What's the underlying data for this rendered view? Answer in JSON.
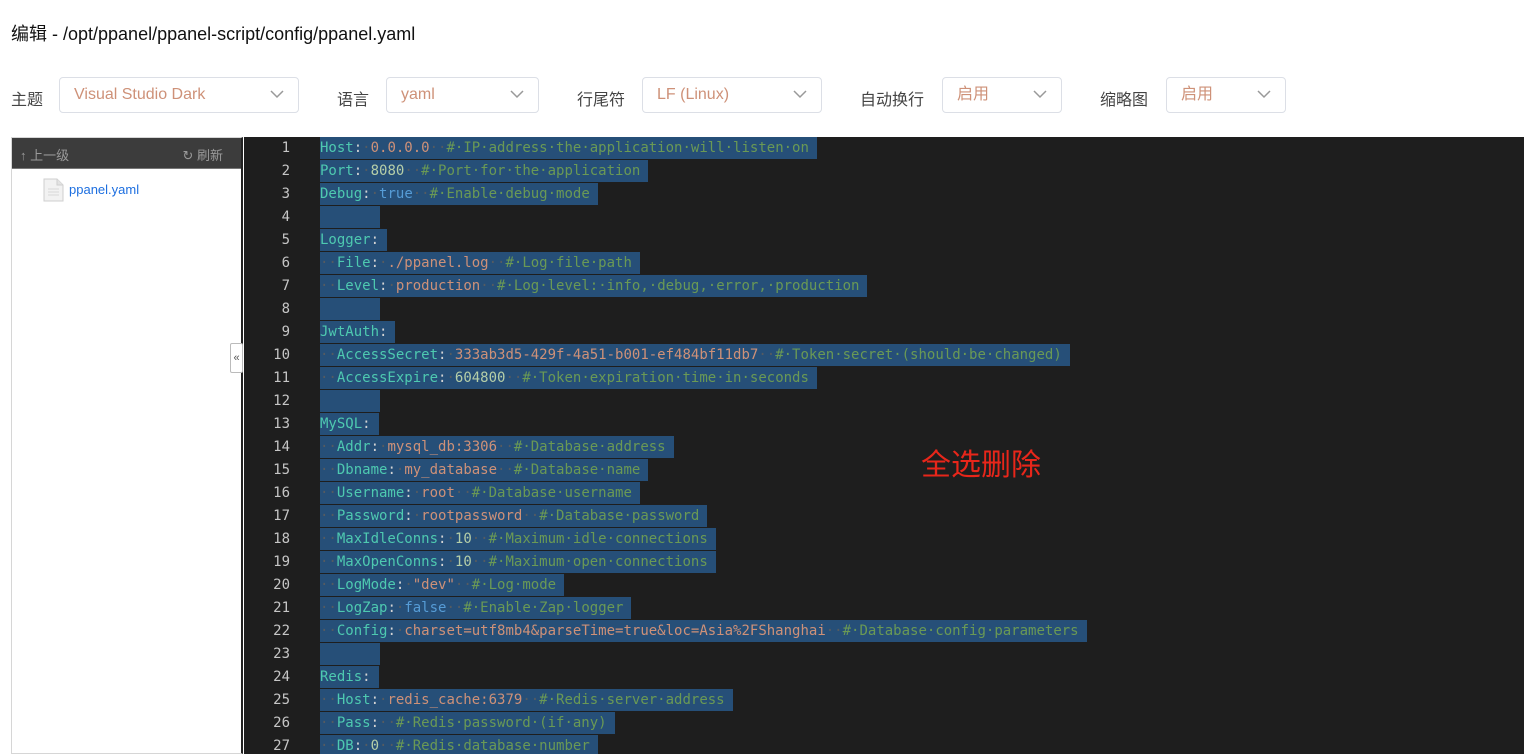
{
  "title": "编辑 - /opt/ppanel/ppanel-script/config/ppanel.yaml",
  "toolbar": {
    "theme_label": "主题",
    "theme_value": "Visual Studio Dark",
    "language_label": "语言",
    "language_value": "yaml",
    "eol_label": "行尾符",
    "eol_value": "LF (Linux)",
    "wrap_label": "自动换行",
    "wrap_value": "启用",
    "minimap_label": "缩略图",
    "minimap_value": "启用"
  },
  "sidebar": {
    "up_label": "↑ 上一级",
    "refresh_label": "刷新",
    "files": [
      {
        "name": "ppanel.yaml"
      }
    ],
    "collapse_glyph": "«"
  },
  "editor": {
    "lines": [
      {
        "n": "1",
        "indent": 0,
        "key": "Host",
        "value": "0.0.0.0",
        "vtype": "val",
        "comment": "# IP address the application will listen on"
      },
      {
        "n": "2",
        "indent": 0,
        "key": "Port",
        "value": "8080",
        "vtype": "num",
        "comment": "# Port for the application"
      },
      {
        "n": "3",
        "indent": 0,
        "key": "Debug",
        "value": "true",
        "vtype": "bool",
        "comment": "# Enable debug mode"
      },
      {
        "n": "4",
        "indent": 0,
        "empty": true
      },
      {
        "n": "5",
        "indent": 0,
        "key": "Logger",
        "value": "",
        "vtype": "val",
        "comment": ""
      },
      {
        "n": "6",
        "indent": 2,
        "key": "File",
        "value": "./ppanel.log",
        "vtype": "val",
        "comment": "# Log file path"
      },
      {
        "n": "7",
        "indent": 2,
        "key": "Level",
        "value": "production",
        "vtype": "val",
        "comment": "# Log level: info, debug, error, production"
      },
      {
        "n": "8",
        "indent": 0,
        "empty": true
      },
      {
        "n": "9",
        "indent": 0,
        "key": "JwtAuth",
        "value": "",
        "vtype": "val",
        "comment": ""
      },
      {
        "n": "10",
        "indent": 2,
        "key": "AccessSecret",
        "value": "333ab3d5-429f-4a51-b001-ef484bf11db7",
        "vtype": "val",
        "comment": "# Token secret (should be changed)"
      },
      {
        "n": "11",
        "indent": 2,
        "key": "AccessExpire",
        "value": "604800",
        "vtype": "num",
        "comment": "# Token expiration time in seconds"
      },
      {
        "n": "12",
        "indent": 0,
        "empty": true
      },
      {
        "n": "13",
        "indent": 0,
        "key": "MySQL",
        "value": "",
        "vtype": "val",
        "comment": ""
      },
      {
        "n": "14",
        "indent": 2,
        "key": "Addr",
        "value": "mysql_db:3306",
        "vtype": "val",
        "comment": "# Database address"
      },
      {
        "n": "15",
        "indent": 2,
        "key": "Dbname",
        "value": "my_database",
        "vtype": "val",
        "comment": "# Database name"
      },
      {
        "n": "16",
        "indent": 2,
        "key": "Username",
        "value": "root",
        "vtype": "val",
        "comment": "# Database username"
      },
      {
        "n": "17",
        "indent": 2,
        "key": "Password",
        "value": "rootpassword",
        "vtype": "val",
        "comment": "# Database password"
      },
      {
        "n": "18",
        "indent": 2,
        "key": "MaxIdleConns",
        "value": "10",
        "vtype": "num",
        "comment": "# Maximum idle connections"
      },
      {
        "n": "19",
        "indent": 2,
        "key": "MaxOpenConns",
        "value": "10",
        "vtype": "num",
        "comment": "# Maximum open connections"
      },
      {
        "n": "20",
        "indent": 2,
        "key": "LogMode",
        "value": "\"dev\"",
        "vtype": "val",
        "comment": "# Log mode"
      },
      {
        "n": "21",
        "indent": 2,
        "key": "LogZap",
        "value": "false",
        "vtype": "bool",
        "comment": "# Enable Zap logger"
      },
      {
        "n": "22",
        "indent": 2,
        "key": "Config",
        "value": "charset=utf8mb4&parseTime=true&loc=Asia%2FShanghai",
        "vtype": "val",
        "comment": "# Database config parameters"
      },
      {
        "n": "23",
        "indent": 0,
        "empty": true
      },
      {
        "n": "24",
        "indent": 0,
        "key": "Redis",
        "value": "",
        "vtype": "val",
        "comment": ""
      },
      {
        "n": "25",
        "indent": 2,
        "key": "Host",
        "value": "redis_cache:6379",
        "vtype": "val",
        "comment": "# Redis server address"
      },
      {
        "n": "26",
        "indent": 2,
        "key": "Pass",
        "value": "",
        "vtype": "val",
        "comment": "# Redis password (if any)"
      },
      {
        "n": "27",
        "indent": 2,
        "key": "DB",
        "value": "0",
        "vtype": "num",
        "comment": "# Redis database number"
      }
    ]
  },
  "annotation": "全选删除",
  "colors": {
    "editor_bg": "#1e1e1e",
    "selection": "#264f78",
    "key": "#4ec9b0",
    "string": "#ce9178",
    "number": "#b5cea8",
    "bool": "#569cd6",
    "comment": "#6a9955",
    "annotation": "#e8261a"
  }
}
